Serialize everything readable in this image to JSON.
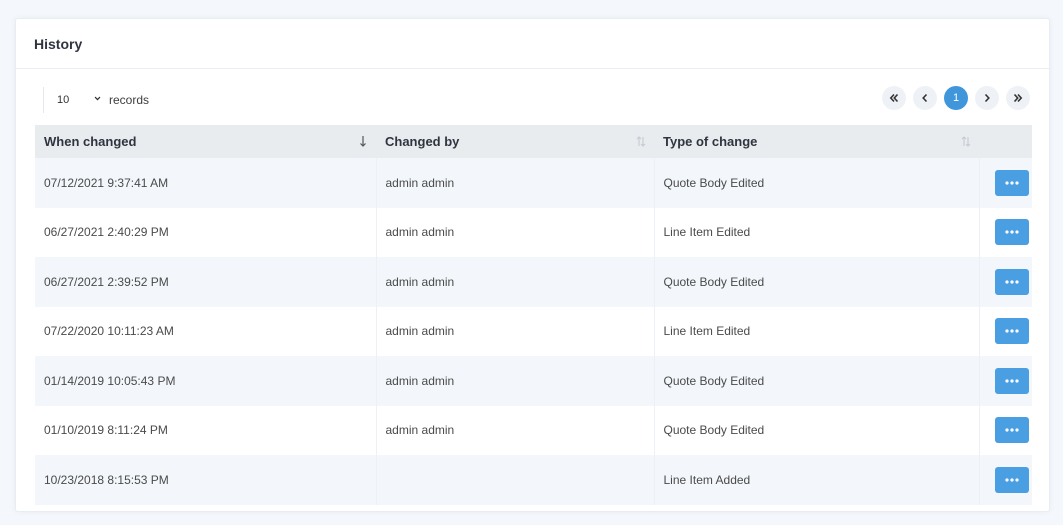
{
  "panel": {
    "title": "History"
  },
  "records": {
    "page_size": "10",
    "label": "records"
  },
  "pager": {
    "current_page": "1"
  },
  "table": {
    "columns": [
      "When changed",
      "Changed by",
      "Type of change"
    ],
    "rows": [
      {
        "when": "07/12/2021 9:37:41 AM",
        "by": "admin admin",
        "type": "Quote Body Edited"
      },
      {
        "when": "06/27/2021 2:40:29 PM",
        "by": "admin admin",
        "type": "Line Item Edited"
      },
      {
        "when": "06/27/2021 2:39:52 PM",
        "by": "admin admin",
        "type": "Quote Body Edited"
      },
      {
        "when": "07/22/2020 10:11:23 AM",
        "by": "admin admin",
        "type": "Line Item Edited"
      },
      {
        "when": "01/14/2019 10:05:43 PM",
        "by": "admin admin",
        "type": "Quote Body Edited"
      },
      {
        "when": "01/10/2019 8:11:24 PM",
        "by": "admin admin",
        "type": "Quote Body Edited"
      },
      {
        "when": "10/23/2018 8:15:53 PM",
        "by": "",
        "type": "Line Item Added"
      }
    ]
  },
  "colors": {
    "accent": "#3f96db",
    "action_button": "#4a9ee2",
    "header_bg": "#e9ecef",
    "stripe": "#f3f7fb"
  },
  "icons": {
    "first": "double-chevron-left-icon",
    "prev": "chevron-left-icon",
    "next": "chevron-right-icon",
    "last": "double-chevron-right-icon",
    "more": "ellipsis-icon",
    "sort": "sort-icon"
  }
}
